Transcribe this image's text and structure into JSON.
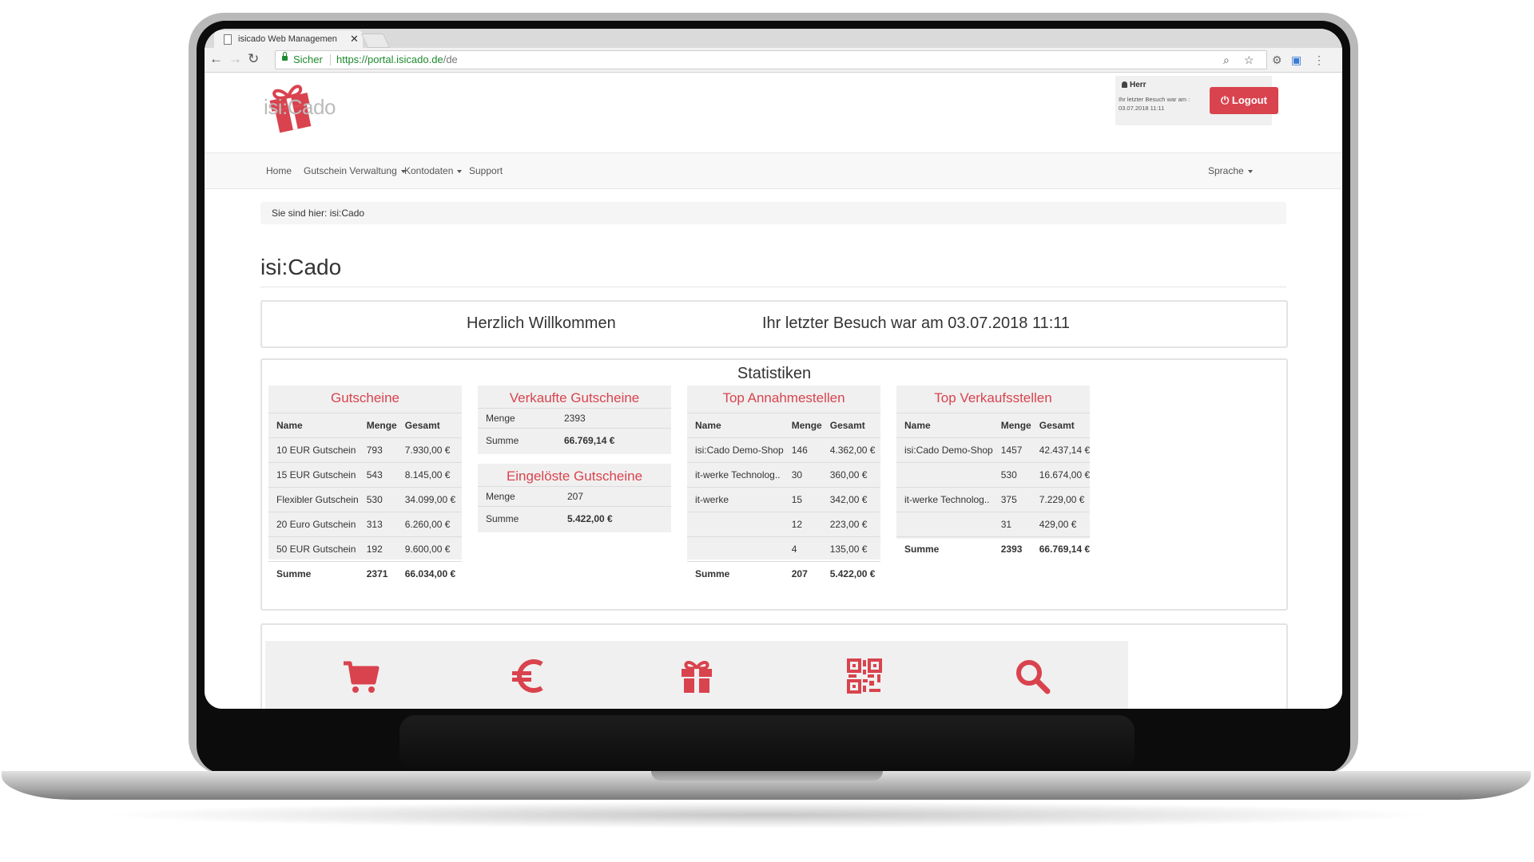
{
  "browser": {
    "tab_title": "isicado Web Managemen",
    "tab_close": "✕",
    "secure_label": "Sicher",
    "url_base": "https://portal.isicado.de",
    "url_path": "/de"
  },
  "header": {
    "logo_text": "isi:Cado",
    "user_name": "Herr",
    "last_visit_note": "Ihr letzter Besuch war am : 03.07.2018 11:11",
    "logout_label": "Logout"
  },
  "nav": {
    "items": [
      "Home",
      "Gutschein Verwaltung",
      "Kontodaten",
      "Support"
    ],
    "language_label": "Sprache"
  },
  "breadcrumb": "Sie sind hier: isi:Cado",
  "page_title": "isi:Cado",
  "welcome": {
    "greeting": "Herzlich Willkommen",
    "last_visit": "Ihr letzter Besuch war am 03.07.2018 11:11"
  },
  "stats": {
    "title": "Statistiken",
    "gutscheine": {
      "title": "Gutscheine",
      "headers": [
        "Name",
        "Menge",
        "Gesamt"
      ],
      "rows": [
        [
          "10 EUR Gutschein",
          "793",
          "7.930,00 €"
        ],
        [
          "15 EUR Gutschein",
          "543",
          "8.145,00 €"
        ],
        [
          "Flexibler Gutschein",
          "530",
          "34.099,00 €"
        ],
        [
          "20 Euro Gutschein",
          "313",
          "6.260,00 €"
        ],
        [
          "50 EUR Gutschein",
          "192",
          "9.600,00 €"
        ]
      ],
      "sum": [
        "Summe",
        "2371",
        "66.034,00 €"
      ]
    },
    "verkaufte": {
      "title": "Verkaufte Gutscheine",
      "menge_label": "Menge",
      "menge_value": "2393",
      "summe_label": "Summe",
      "summe_value": "66.769,14 €"
    },
    "eingeloeste": {
      "title": "Eingelöste Gutscheine",
      "menge_label": "Menge",
      "menge_value": "207",
      "summe_label": "Summe",
      "summe_value": "5.422,00 €"
    },
    "annahmestellen": {
      "title": "Top Annahmestellen",
      "headers": [
        "Name",
        "Menge",
        "Gesamt"
      ],
      "rows": [
        [
          "isi:Cado Demo-Shop",
          "146",
          "4.362,00 €"
        ],
        [
          "it-werke Technolog..",
          "30",
          "360,00 €"
        ],
        [
          "it-werke",
          "15",
          "342,00 €"
        ],
        [
          "",
          "12",
          "223,00 €"
        ],
        [
          "",
          "4",
          "135,00 €"
        ]
      ],
      "sum": [
        "Summe",
        "207",
        "5.422,00 €"
      ]
    },
    "verkaufsstellen": {
      "title": "Top Verkaufsstellen",
      "headers": [
        "Name",
        "Menge",
        "Gesamt"
      ],
      "rows": [
        [
          "isi:Cado Demo-Shop",
          "1457",
          "42.437,14 €"
        ],
        [
          "",
          "530",
          "16.674,00 €"
        ],
        [
          "it-werke Technolog..",
          "375",
          "7.229,00 €"
        ],
        [
          "",
          "31",
          "429,00 €"
        ]
      ],
      "sum": [
        "Summe",
        "2393",
        "66.769,14 €"
      ]
    }
  },
  "tiles": [
    "cart-icon",
    "euro-icon",
    "gift-icon",
    "qr-code-icon",
    "search-icon"
  ],
  "colors": {
    "accent": "#d9434e",
    "secure": "#1e8a2e",
    "panel": "#f0f0f0"
  }
}
